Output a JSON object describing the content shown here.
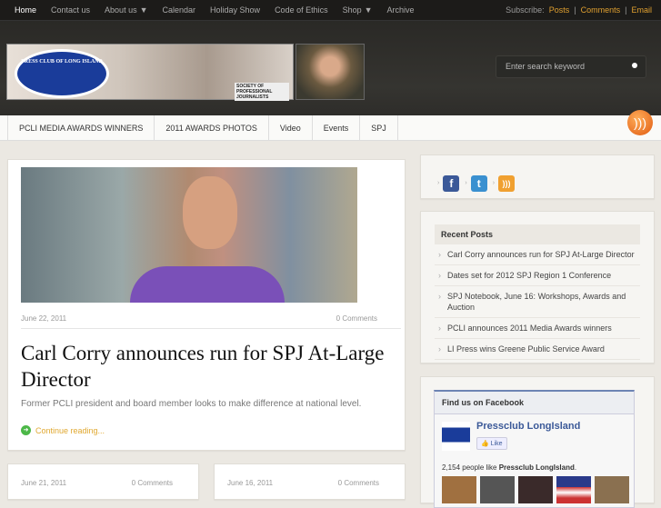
{
  "topbar": {
    "menu": [
      {
        "label": "Home"
      },
      {
        "label": "Contact us"
      },
      {
        "label": "About us",
        "dropdown": true
      },
      {
        "label": "Calendar"
      },
      {
        "label": "Holiday Show"
      },
      {
        "label": "Code of Ethics"
      },
      {
        "label": "Shop",
        "dropdown": true
      },
      {
        "label": "Archive"
      }
    ],
    "subscribe_label": "Subscribe:",
    "subscribe_links": [
      "Posts",
      "Comments",
      "Email"
    ],
    "separator": "|"
  },
  "header": {
    "logo_text": "PRESS CLUB OF LONG ISLAND",
    "spj_text": "SOCIETY OF PROFESSIONAL JOURNALISTS",
    "search_placeholder": "Enter search keyword"
  },
  "nav": [
    "PCLI MEDIA AWARDS WINNERS",
    "2011 AWARDS PHOTOS",
    "Video",
    "Events",
    "SPJ"
  ],
  "featured": {
    "date": "June 22, 2011",
    "comments": "0 Comments",
    "title": "Carl Corry announces run for SPJ At-Large Director",
    "excerpt": "Former PCLI president and board member looks to make difference at national level.",
    "continue": "Continue reading..."
  },
  "more_posts": [
    {
      "date": "June 21, 2011",
      "comments": "0 Comments"
    },
    {
      "date": "June 16, 2011",
      "comments": "0 Comments"
    }
  ],
  "sidebar": {
    "social": [
      "facebook",
      "twitter",
      "rss"
    ],
    "recent_title": "Recent Posts",
    "recent": [
      "Carl Corry announces run for SPJ At-Large Director",
      "Dates set for 2012 SPJ Region 1 Conference",
      "SPJ Notebook, June 16: Workshops, Awards and Auction",
      "PCLI announces 2011 Media Awards winners",
      "LI Press wins Greene Public Service Award"
    ],
    "facebook": {
      "title": "Find us on Facebook",
      "page_name": "Pressclub LongIsland",
      "like": "Like",
      "count_text": "2,154 people like ",
      "count_page": "Pressclub LongIsland",
      "period": "."
    }
  },
  "colors": {
    "accent": "#e0a030",
    "fb": "#3b5998"
  }
}
